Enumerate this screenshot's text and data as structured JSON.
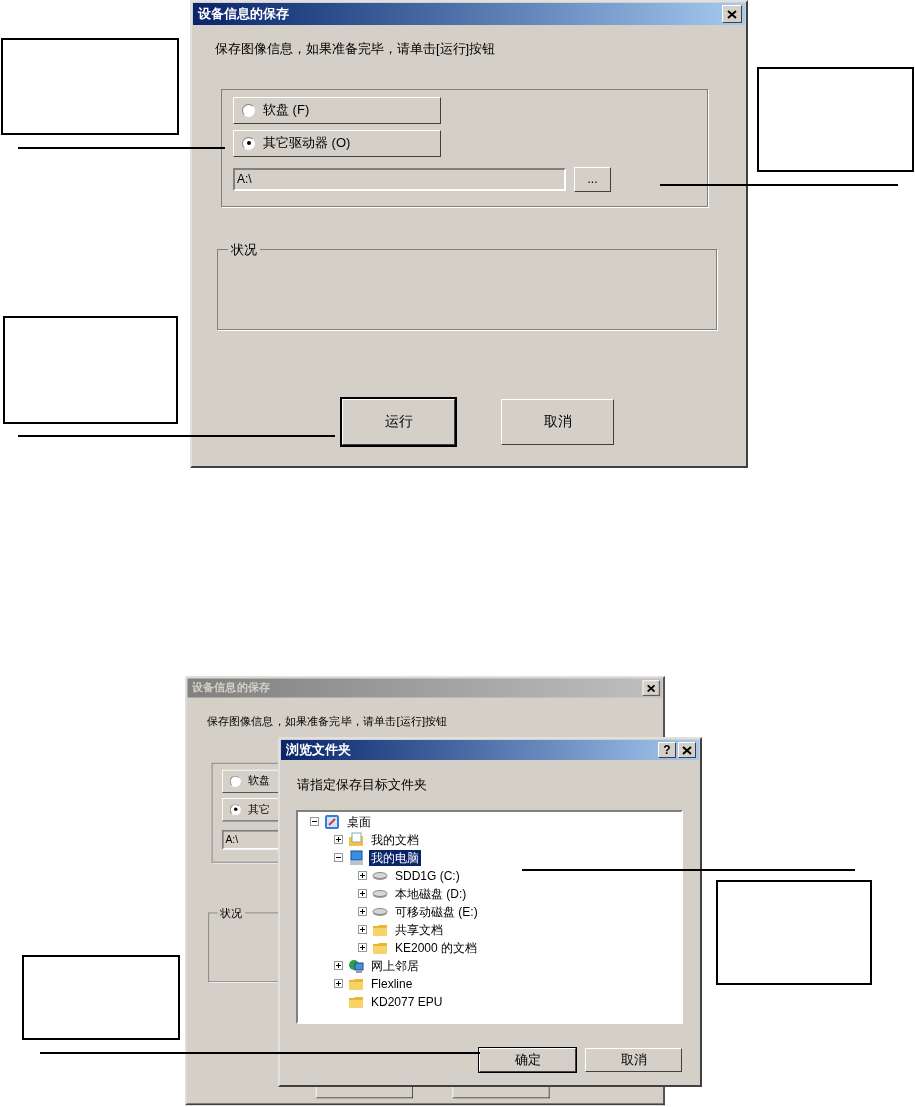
{
  "dialogs": [
    {
      "title": "设备信息的保存",
      "active": true,
      "message": "保存图像信息，如果准备完毕，请单击[运行]按钮",
      "options": [
        {
          "label": "软盘 (F)",
          "selected": false
        },
        {
          "label": "其它驱动器 (O)",
          "selected": true
        }
      ],
      "path": "A:\\",
      "browse_button": "...",
      "status_label": "状况",
      "buttons": [
        {
          "label": "运行",
          "default": true
        },
        {
          "label": "取消",
          "default": false
        }
      ]
    },
    {
      "title": "设备信息的保存",
      "active": false,
      "message": "保存图像信息，如果准备完毕，请单击[运行]按钮",
      "options": [
        {
          "label": "软盘",
          "selected": false
        },
        {
          "label": "其它",
          "selected": true
        }
      ],
      "path": "A:\\",
      "status_label": "状况"
    }
  ],
  "browse_dialog": {
    "title": "浏览文件夹",
    "help_button": "?",
    "message": "请指定保存目标文件夹",
    "tree": [
      {
        "label": "桌面",
        "kind": "desktop",
        "expandable": true,
        "expanded": true,
        "selected": false,
        "children": [
          {
            "label": "我的文档",
            "kind": "documents",
            "expandable": true,
            "expanded": false,
            "selected": false
          },
          {
            "label": "我的电脑",
            "kind": "computer",
            "expandable": true,
            "expanded": true,
            "selected": true,
            "children": [
              {
                "label": "SDD1G (C:)",
                "kind": "drive",
                "expandable": true,
                "expanded": false,
                "selected": false
              },
              {
                "label": "本地磁盘 (D:)",
                "kind": "drive",
                "expandable": true,
                "expanded": false,
                "selected": false
              },
              {
                "label": "可移动磁盘 (E:)",
                "kind": "drive",
                "expandable": true,
                "expanded": false,
                "selected": false
              },
              {
                "label": "共享文档",
                "kind": "folder",
                "expandable": true,
                "expanded": false,
                "selected": false
              },
              {
                "label": "KE2000 的文档",
                "kind": "folder",
                "expandable": true,
                "expanded": false,
                "selected": false
              }
            ]
          },
          {
            "label": "网上邻居",
            "kind": "network",
            "expandable": true,
            "expanded": false,
            "selected": false
          },
          {
            "label": "Flexline",
            "kind": "folder",
            "expandable": true,
            "expanded": false,
            "selected": false
          },
          {
            "label": "KD2077 EPU",
            "kind": "folder",
            "expandable": false,
            "selected": false
          }
        ]
      }
    ],
    "buttons": [
      {
        "label": "确定",
        "default": true
      },
      {
        "label": "取消",
        "default": false
      }
    ]
  }
}
